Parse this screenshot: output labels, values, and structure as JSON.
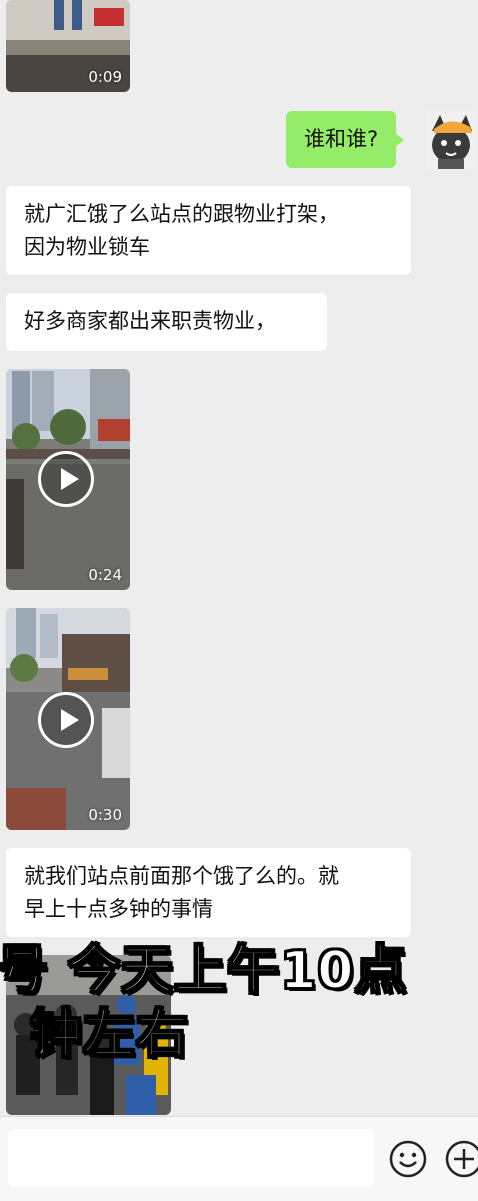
{
  "messages": [
    {
      "type": "video",
      "sender": "other",
      "duration": "0:09"
    },
    {
      "type": "text",
      "sender": "me",
      "text": "谁和谁?"
    },
    {
      "type": "text",
      "sender": "other",
      "lines": [
        "就广汇饿了么站点的跟物业打架，",
        "因为物业锁车"
      ]
    },
    {
      "type": "text",
      "sender": "other",
      "text": "好多商家都出来职责物业，"
    },
    {
      "type": "video",
      "sender": "other",
      "duration": "0:24"
    },
    {
      "type": "video",
      "sender": "other",
      "duration": "0:30"
    },
    {
      "type": "text",
      "sender": "other",
      "lines": [
        "就我们站点前面那个饿了么的。就",
        "早上十点多钟的事情"
      ]
    },
    {
      "type": "video",
      "sender": "other",
      "duration": ""
    }
  ],
  "overlay_caption": {
    "line1": "号 今天上午10点",
    "line2": "钟左右"
  },
  "icons": {
    "emoji": "smile-emoji-icon",
    "plus": "plus-circle-icon",
    "avatar": "cat-avatar-icon"
  },
  "colors": {
    "background": "#ededed",
    "my_bubble": "#95ec69",
    "other_bubble": "#ffffff"
  }
}
